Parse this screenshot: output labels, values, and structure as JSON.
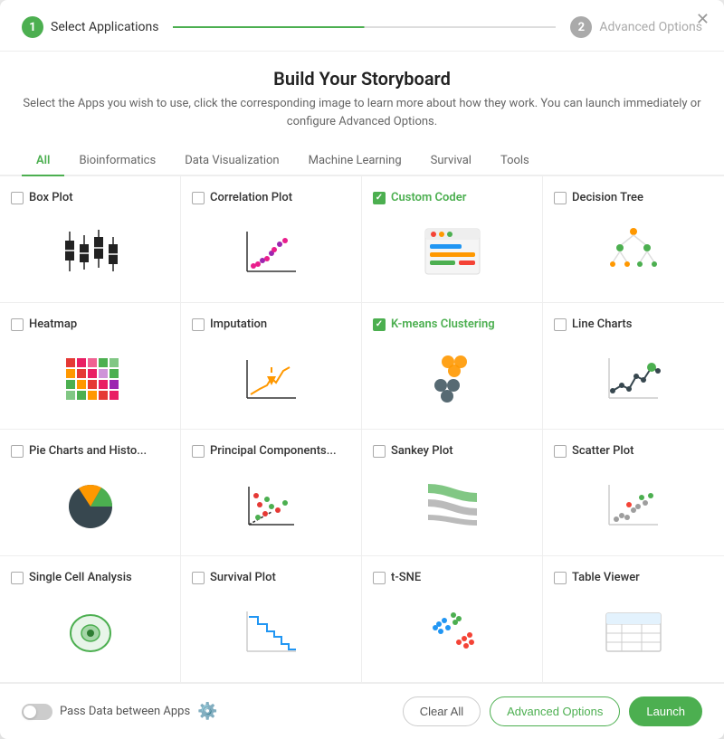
{
  "modal": {
    "close_label": "✕",
    "title": "Build Your Storyboard",
    "subtitle": "Select the Apps you wish to use, click the corresponding image to learn more about how they work. You can launch immediately or configure Advanced Options."
  },
  "stepper": {
    "step1": {
      "number": "1",
      "label": "Select Applications",
      "state": "active"
    },
    "step2": {
      "number": "2",
      "label": "Advanced Options",
      "state": "inactive"
    }
  },
  "tabs": [
    {
      "id": "all",
      "label": "All",
      "active": true
    },
    {
      "id": "bioinformatics",
      "label": "Bioinformatics",
      "active": false
    },
    {
      "id": "data-visualization",
      "label": "Data Visualization",
      "active": false
    },
    {
      "id": "machine-learning",
      "label": "Machine Learning",
      "active": false
    },
    {
      "id": "survival",
      "label": "Survival",
      "active": false
    },
    {
      "id": "tools",
      "label": "Tools",
      "active": false
    }
  ],
  "apps": [
    {
      "id": "box-plot",
      "label": "Box Plot",
      "selected": false
    },
    {
      "id": "correlation-plot",
      "label": "Correlation Plot",
      "selected": false
    },
    {
      "id": "custom-coder",
      "label": "Custom Coder",
      "selected": true
    },
    {
      "id": "decision-tree",
      "label": "Decision Tree",
      "selected": false
    },
    {
      "id": "heatmap",
      "label": "Heatmap",
      "selected": false
    },
    {
      "id": "imputation",
      "label": "Imputation",
      "selected": false
    },
    {
      "id": "k-means-clustering",
      "label": "K-means Clustering",
      "selected": true
    },
    {
      "id": "line-charts",
      "label": "Line Charts",
      "selected": false
    },
    {
      "id": "pie-charts",
      "label": "Pie Charts and Histo...",
      "selected": false
    },
    {
      "id": "principal-components",
      "label": "Principal Components...",
      "selected": false
    },
    {
      "id": "sankey-plot",
      "label": "Sankey Plot",
      "selected": false
    },
    {
      "id": "scatter-plot",
      "label": "Scatter Plot",
      "selected": false
    },
    {
      "id": "single-cell-analysis",
      "label": "Single Cell Analysis",
      "selected": false
    },
    {
      "id": "survival-plot",
      "label": "Survival Plot",
      "selected": false
    },
    {
      "id": "t-sne",
      "label": "t-SNE",
      "selected": false
    },
    {
      "id": "table-viewer",
      "label": "Table Viewer",
      "selected": false
    }
  ],
  "footer": {
    "pass_data_label": "Pass Data between Apps",
    "settings_icon": "⚙",
    "clear_all": "Clear All",
    "advanced_options": "Advanced Options",
    "launch": "Launch"
  }
}
